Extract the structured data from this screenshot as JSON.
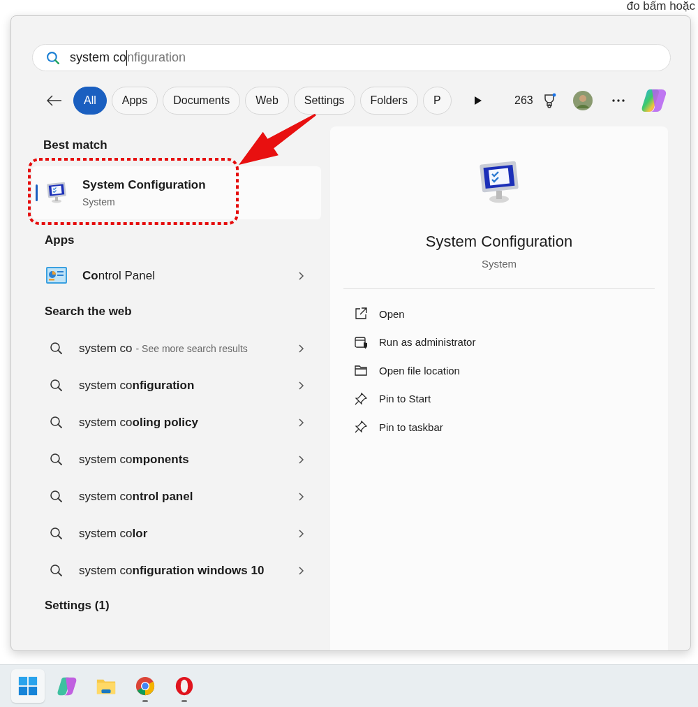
{
  "background_page": {
    "top_text": "đo bấm hoặc"
  },
  "search": {
    "value": "system co",
    "suggestion": "nfiguration"
  },
  "filters": [
    {
      "label": "All",
      "selected": true
    },
    {
      "label": "Apps",
      "selected": false
    },
    {
      "label": "Documents",
      "selected": false
    },
    {
      "label": "Web",
      "selected": false
    },
    {
      "label": "Settings",
      "selected": false
    },
    {
      "label": "Folders",
      "selected": false
    },
    {
      "label": "P",
      "selected": false
    }
  ],
  "toolbar": {
    "points": "263"
  },
  "sections": [
    {
      "heading": "Best match",
      "items": [
        {
          "kind": "best",
          "title": "System Configuration",
          "subtitle": "System",
          "selected": true
        }
      ]
    },
    {
      "heading": "Apps",
      "items": [
        {
          "kind": "app",
          "title": "**Co**ntrol Panel",
          "selected": false
        }
      ]
    },
    {
      "heading": "Search the web",
      "items": [
        {
          "kind": "web",
          "title": "system co",
          "note": "- See more search results",
          "selected": false
        },
        {
          "kind": "web",
          "title": "system co**nfiguration**",
          "selected": false
        },
        {
          "kind": "web",
          "title": "system co**oling policy**",
          "selected": false
        },
        {
          "kind": "web",
          "title": "system co**mponents**",
          "selected": false
        },
        {
          "kind": "web",
          "title": "system co**ntrol panel**",
          "selected": false
        },
        {
          "kind": "web",
          "title": "system co**lor**",
          "selected": false
        },
        {
          "kind": "web",
          "title": "system co**nfiguration windows 10**",
          "selected": false
        }
      ]
    },
    {
      "heading": "Settings (1)"
    }
  ],
  "details": {
    "title": "System Configuration",
    "subtitle": "System",
    "actions": [
      {
        "kind": "open",
        "label": "Open"
      },
      {
        "kind": "admin",
        "label": "Run as administrator"
      },
      {
        "kind": "folder",
        "label": "Open file location"
      },
      {
        "kind": "pin",
        "label": "Pin to Start"
      },
      {
        "kind": "pin",
        "label": "Pin to taskbar"
      }
    ]
  },
  "taskbar": [
    {
      "kind": "start",
      "selected": true,
      "running": false
    },
    {
      "kind": "copilot",
      "selected": false,
      "running": false
    },
    {
      "kind": "files",
      "selected": false,
      "running": false
    },
    {
      "kind": "chrome",
      "selected": false,
      "running": true
    },
    {
      "kind": "opera",
      "selected": false,
      "running": true
    }
  ]
}
